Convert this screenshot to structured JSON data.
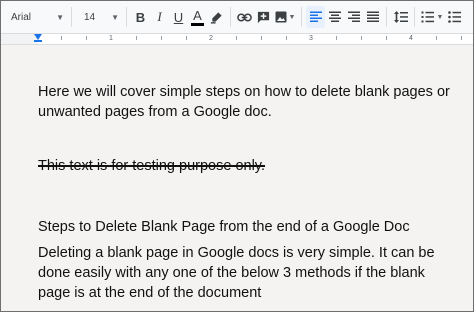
{
  "toolbar": {
    "font_family": "Arial",
    "font_size": "14",
    "bold_label": "B",
    "italic_label": "I",
    "underline_label": "U",
    "text_color_label": "A"
  },
  "ruler": {
    "numbers": [
      "1",
      "2",
      "3",
      "4"
    ]
  },
  "document": {
    "paragraph_1": "Here we will cover simple steps on how to delete blank pages or unwanted pages from a Google doc.",
    "paragraph_2": "This text is for testing purpose only.",
    "heading_1": "Steps to Delete Blank Page from the end of a Google Doc",
    "paragraph_3": "Deleting a blank page in Google docs is very simple. It can be done easily with any one of the below 3 methods if the blank page is at the end of the document"
  },
  "colors": {
    "accent": "#1a73e8",
    "page_background": "#f4f3f2",
    "toolbar_background": "#f8f9fa"
  }
}
